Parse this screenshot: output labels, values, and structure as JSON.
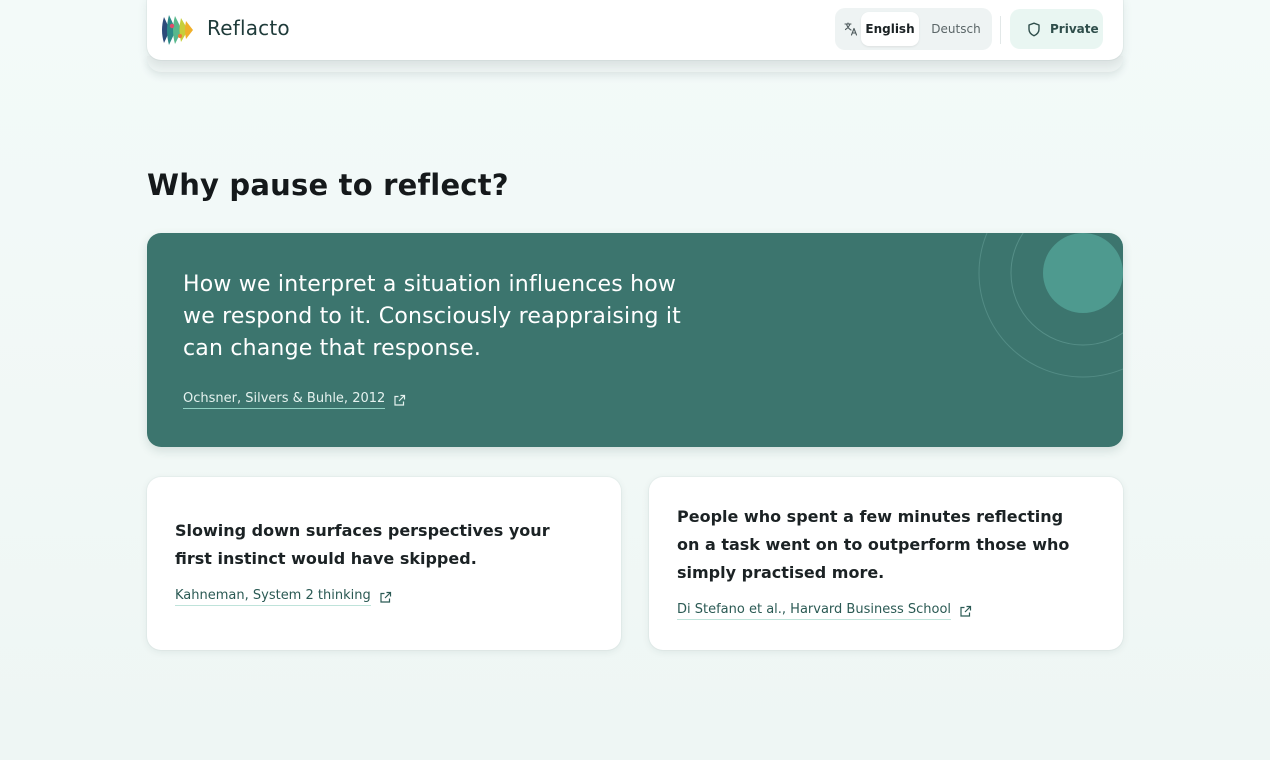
{
  "header": {
    "brand": "Reflacto",
    "languages": [
      "English",
      "Deutsch"
    ],
    "selected_language": "English",
    "private_label": "Private"
  },
  "main": {
    "section_title": "Why pause to reflect?",
    "hero": {
      "quote": "How we interpret a situation influences how we respond to it. Consciously reappraising it can change that response.",
      "citation": "Ochsner, Silvers & Buhle, 2012"
    },
    "cards": [
      {
        "text": "Slowing down surfaces perspectives your first instinct would have skipped.",
        "citation": "Kahneman, System 2 thinking"
      },
      {
        "text": "People who spent a few minutes reflecting on a task went on to outperform those who simply practised more.",
        "citation": "Di Stefano et al., Harvard Business School"
      }
    ]
  },
  "colors": {
    "accent": "#3c756e",
    "background": "#f1f8f7",
    "accent_light": "#e9f6f2"
  },
  "icons": {
    "logo": "reflacto-logo",
    "translate": "translate-icon",
    "private": "shield-icon",
    "citation_link": "external-link-icon"
  }
}
